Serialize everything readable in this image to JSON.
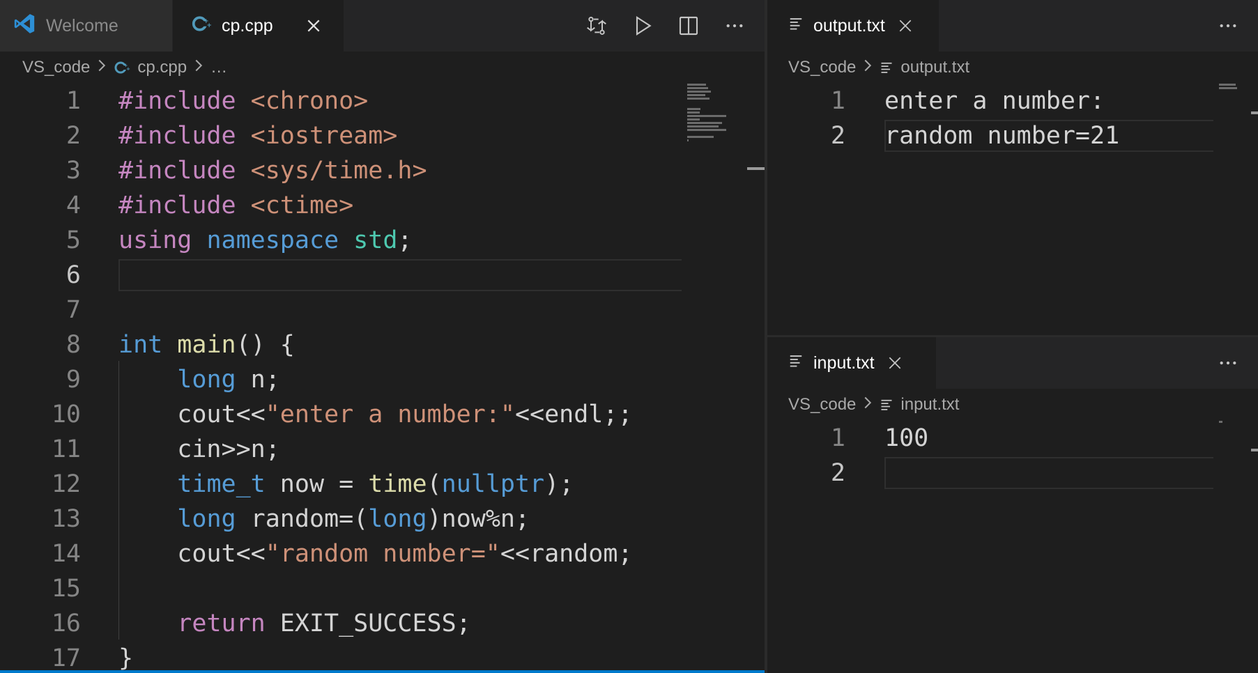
{
  "left": {
    "tabs": [
      {
        "label": "Welcome",
        "icon": "vscode-logo-icon",
        "active": false
      },
      {
        "label": "cp.cpp",
        "icon": "cpp-file-icon",
        "active": true
      }
    ],
    "actions": [
      "source-control-compare-icon",
      "run-icon",
      "split-editor-icon",
      "more-actions-icon"
    ],
    "breadcrumb": {
      "folder": "VS_code",
      "file": "cp.cpp",
      "rest": "…"
    },
    "current_line": 6,
    "lines": [
      {
        "n": "1",
        "tokens": [
          {
            "t": "#include",
            "c": "kw"
          },
          {
            "t": " "
          },
          {
            "t": "<chrono>",
            "c": "inc"
          }
        ]
      },
      {
        "n": "2",
        "tokens": [
          {
            "t": "#include",
            "c": "kw"
          },
          {
            "t": " "
          },
          {
            "t": "<iostream>",
            "c": "inc"
          }
        ]
      },
      {
        "n": "3",
        "tokens": [
          {
            "t": "#include",
            "c": "kw"
          },
          {
            "t": " "
          },
          {
            "t": "<sys/time.h>",
            "c": "inc"
          }
        ]
      },
      {
        "n": "4",
        "tokens": [
          {
            "t": "#include",
            "c": "kw"
          },
          {
            "t": " "
          },
          {
            "t": "<ctime>",
            "c": "inc"
          }
        ]
      },
      {
        "n": "5",
        "tokens": [
          {
            "t": "using",
            "c": "kw"
          },
          {
            "t": " "
          },
          {
            "t": "namespace",
            "c": "ty"
          },
          {
            "t": " "
          },
          {
            "t": "std",
            "c": "ns"
          },
          {
            "t": ";"
          }
        ]
      },
      {
        "n": "6",
        "tokens": []
      },
      {
        "n": "7",
        "tokens": []
      },
      {
        "n": "8",
        "tokens": [
          {
            "t": "int",
            "c": "ty"
          },
          {
            "t": " "
          },
          {
            "t": "main",
            "c": "fn"
          },
          {
            "t": "() {"
          }
        ]
      },
      {
        "n": "9",
        "tokens": [
          {
            "t": "    "
          },
          {
            "t": "long",
            "c": "ty"
          },
          {
            "t": " n;"
          }
        ]
      },
      {
        "n": "10",
        "tokens": [
          {
            "t": "    cout<<"
          },
          {
            "t": "\"enter a number:\"",
            "c": "str"
          },
          {
            "t": "<<endl;;"
          }
        ]
      },
      {
        "n": "11",
        "tokens": [
          {
            "t": "    cin>>n;"
          }
        ]
      },
      {
        "n": "12",
        "tokens": [
          {
            "t": "    "
          },
          {
            "t": "time_t",
            "c": "ty"
          },
          {
            "t": " now = "
          },
          {
            "t": "time",
            "c": "fn"
          },
          {
            "t": "("
          },
          {
            "t": "nullptr",
            "c": "ty"
          },
          {
            "t": ");"
          }
        ]
      },
      {
        "n": "13",
        "tokens": [
          {
            "t": "    "
          },
          {
            "t": "long",
            "c": "ty"
          },
          {
            "t": " random=("
          },
          {
            "t": "long",
            "c": "ty"
          },
          {
            "t": ")now%n;"
          }
        ]
      },
      {
        "n": "14",
        "tokens": [
          {
            "t": "    cout<<"
          },
          {
            "t": "\"random number=\"",
            "c": "str"
          },
          {
            "t": "<<random;"
          }
        ]
      },
      {
        "n": "15",
        "tokens": []
      },
      {
        "n": "16",
        "tokens": [
          {
            "t": "    "
          },
          {
            "t": "return",
            "c": "kw"
          },
          {
            "t": " EXIT_SUCCESS;"
          }
        ]
      },
      {
        "n": "17",
        "tokens": [
          {
            "t": "}"
          }
        ]
      }
    ]
  },
  "output": {
    "tab": {
      "label": "output.txt",
      "icon": "text-file-icon"
    },
    "more": "more-actions-icon",
    "breadcrumb": {
      "folder": "VS_code",
      "file": "output.txt"
    },
    "current_line": 2,
    "lines": [
      {
        "n": "1",
        "tokens": [
          {
            "t": "enter a number:"
          }
        ]
      },
      {
        "n": "2",
        "tokens": [
          {
            "t": "random number=21"
          }
        ]
      }
    ]
  },
  "input": {
    "tab": {
      "label": "input.txt",
      "icon": "text-file-icon"
    },
    "more": "more-actions-icon",
    "breadcrumb": {
      "folder": "VS_code",
      "file": "input.txt"
    },
    "current_line": 2,
    "lines": [
      {
        "n": "1",
        "tokens": [
          {
            "t": "100"
          }
        ]
      },
      {
        "n": "2",
        "tokens": []
      }
    ]
  }
}
